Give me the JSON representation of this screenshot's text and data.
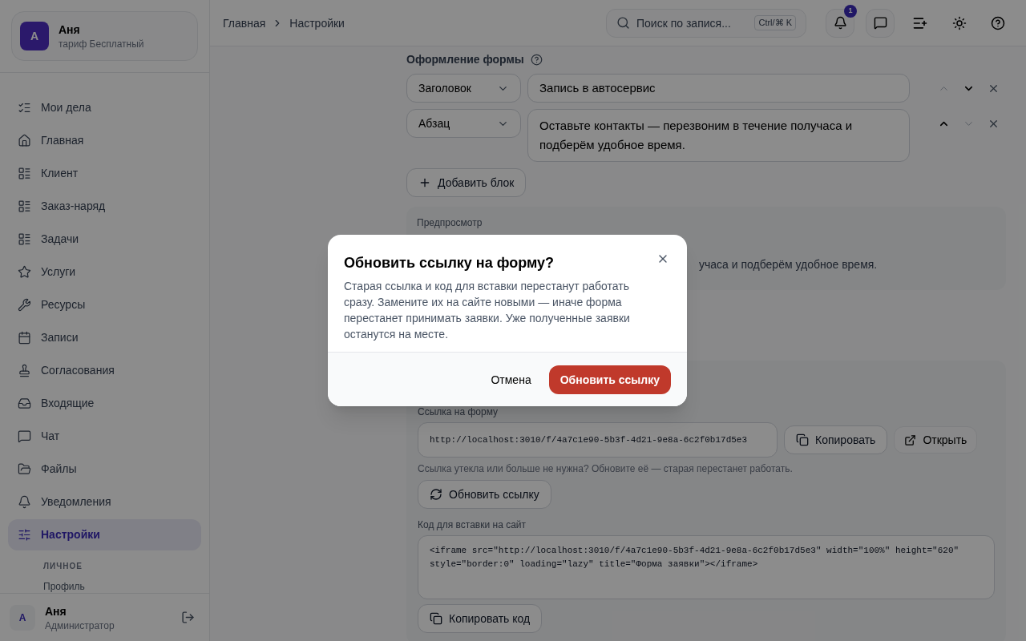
{
  "sidebar": {
    "account": {
      "initial": "А",
      "name": "Аня",
      "plan": "тариф Бесплатный"
    },
    "items": [
      {
        "kind": "checklist",
        "label": "Мои дела",
        "selected": false
      },
      {
        "kind": "home",
        "label": "Главная",
        "selected": false
      },
      {
        "kind": "grid",
        "label": "Клиент",
        "selected": false
      },
      {
        "kind": "grid",
        "label": "Заказ-наряд",
        "selected": false
      },
      {
        "kind": "grid",
        "label": "Задачи",
        "selected": false
      },
      {
        "kind": "star",
        "label": "Услуги",
        "selected": false
      },
      {
        "kind": "wrench",
        "label": "Ресурсы",
        "selected": false
      },
      {
        "kind": "calendar",
        "label": "Записи",
        "selected": false
      },
      {
        "kind": "stamp",
        "label": "Согласования",
        "selected": false
      },
      {
        "kind": "inbox",
        "label": "Входящие",
        "selected": false
      },
      {
        "kind": "chat",
        "label": "Чат",
        "selected": false
      },
      {
        "kind": "folder",
        "label": "Файлы",
        "selected": false
      },
      {
        "kind": "bell",
        "label": "Уведомления",
        "selected": false
      },
      {
        "kind": "sliders",
        "label": "Настройки",
        "selected": true
      }
    ],
    "section": "ЛИЧНОЕ",
    "sub_items": [
      "Профиль"
    ],
    "user": {
      "initial": "А",
      "name": "Аня",
      "role": "Администратор"
    }
  },
  "breadcrumbs": [
    "Главная",
    "Настройки"
  ],
  "search": {
    "placeholder": "Поиск по запися...",
    "shortcut": "Ctrl/⌘ K"
  },
  "notifications_badge": "1",
  "form_design": {
    "title": "Оформление формы",
    "blocks": [
      {
        "type": "Заголовок",
        "value": "Запись в автосервис",
        "up_disabled": true,
        "down_disabled": false
      },
      {
        "type": "Абзац",
        "value": "Оставьте контакты — перезвоним в течение получаса и подберём удобное время.",
        "up_disabled": false,
        "down_disabled": true
      }
    ],
    "add_button": "Добавить блок"
  },
  "preview": {
    "label": "Предпросмотр",
    "text": "учаса и подберём удобное время."
  },
  "link": {
    "label": "Ссылка на форму",
    "url": "http://localhost:3010/f/4a7c1e90-5b3f-4d21-9e8a-6c2f0b17d5e3",
    "copy_button": "Копировать",
    "open_button": "Открыть",
    "hint": "Ссылка утекла или больше не нужна? Обновите её — старая перестанет работать.",
    "refresh_button": "Обновить ссылку",
    "embed_label": "Код для вставки на сайт",
    "embed_code": "<iframe src=\"http://localhost:3010/f/4a7c1e90-5b3f-4d21-9e8a-6c2f0b17d5e3\" width=\"100%\" height=\"620\" style=\"border:0\" loading=\"lazy\" title=\"Форма заявки\"></iframe>",
    "copy_code_button": "Копировать код"
  },
  "dialog": {
    "title": "Обновить ссылку на форму?",
    "body": "Старая ссылка и код для вставки перестанут работать сразу. Замените их на сайте новыми — иначе форма перестанет принимать заявки. Уже полученные заявки останутся на месте.",
    "cancel": "Отмена",
    "confirm": "Обновить ссылку"
  }
}
